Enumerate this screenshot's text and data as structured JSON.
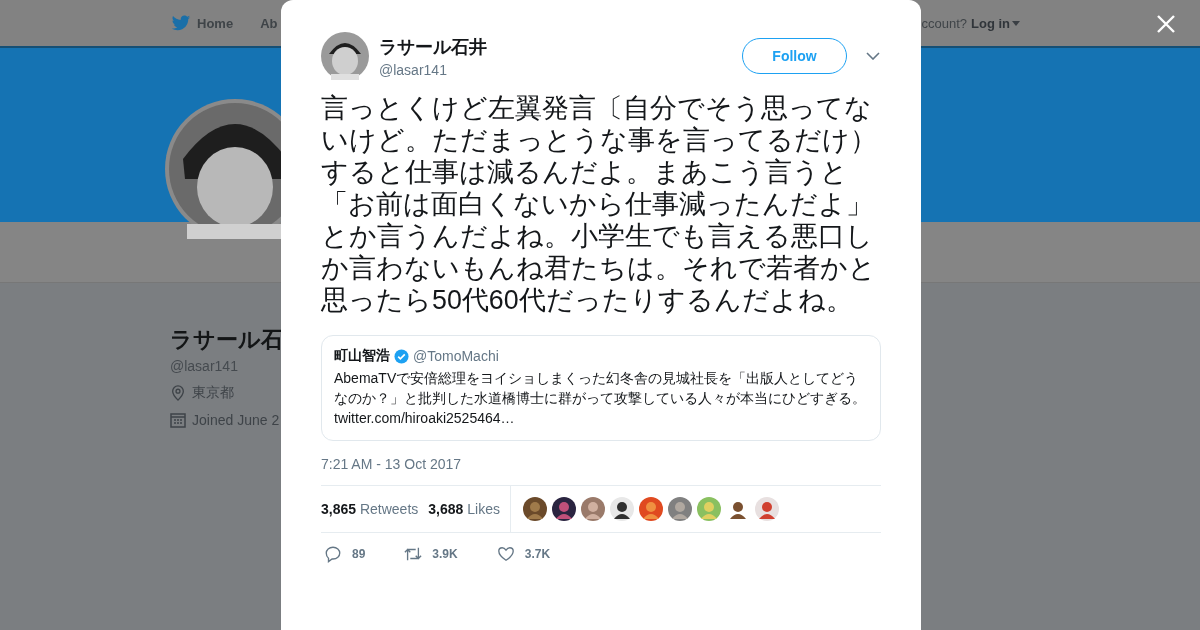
{
  "background_page": {
    "nav": [
      {
        "label": "Home",
        "kind": "home"
      },
      {
        "label": "Ab",
        "kind": "text"
      }
    ],
    "login_prompt": "ccount?",
    "login_link": "Log in",
    "profile": {
      "name": "ラサール石",
      "handle": "@lasar141",
      "location": "東京都",
      "joined": "Joined June 2"
    }
  },
  "tweet": {
    "author": {
      "name": "ラサール石井",
      "handle": "@lasar141"
    },
    "follow_button": "Follow",
    "text": "言っとくけど左翼発言〔自分でそう思ってないけど。ただまっとうな事を言ってるだけ）すると仕事は減るんだよ。まあこう言うと「お前は面白くないから仕事減ったんだよ」とか言うんだよね。小学生でも言える悪口しか言わないもんね君たちは。それで若者かと思ったら50代60代だったりするんだよね。",
    "quoted": {
      "name": "町山智浩",
      "verified": true,
      "handle": "@TomoMachi",
      "text": "AbemaTVで安倍総理をヨイショしまくった幻冬舎の見城社長を「出版人としてどうなのか？」と批判した水道橋博士に群がって攻撃している人々が本当にひどすぎる。",
      "link": "twitter.com/hiroaki2525464…"
    },
    "timestamp": "7:21 AM - 13 Oct 2017",
    "stats": [
      {
        "count": "3,865",
        "label": "Retweets"
      },
      {
        "count": "3,688",
        "label": "Likes"
      }
    ],
    "actions": [
      {
        "kind": "reply",
        "count": "89"
      },
      {
        "kind": "retweet",
        "count": "3.9K"
      },
      {
        "kind": "like",
        "count": "3.7K"
      }
    ]
  }
}
